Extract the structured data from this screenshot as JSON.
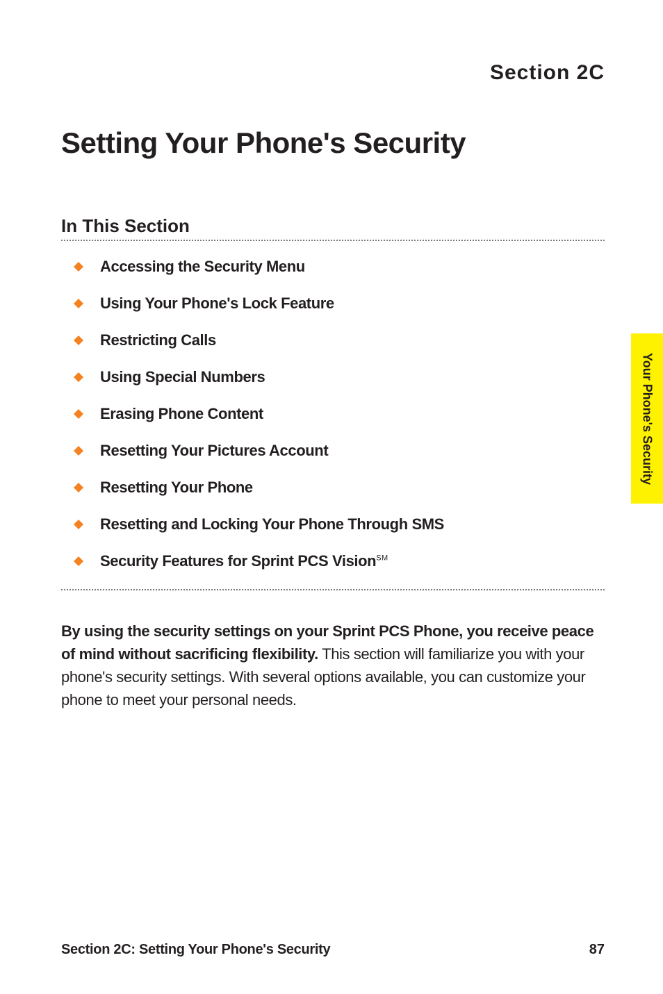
{
  "section_label": "Section 2C",
  "page_title": "Setting Your Phone's Security",
  "sub_heading": "In This Section",
  "bullets": [
    "Accessing the Security Menu",
    "Using Your Phone's Lock Feature",
    "Restricting Calls",
    "Using Special Numbers",
    "Erasing Phone Content",
    "Resetting Your Pictures Account",
    "Resetting Your Phone",
    "Resetting and Locking Your Phone Through SMS",
    "Security Features for Sprint PCS Vision"
  ],
  "last_bullet_mark": "SM",
  "body_bold": "By using the security settings on your Sprint PCS Phone, you receive peace of mind without sacrificing flexibility.",
  "body_rest": " This section will familiarize you with your phone's security settings. With several options available, you can customize your phone to meet your personal needs.",
  "side_tab": "Your Phone's Security",
  "footer_title": "Section 2C: Setting Your Phone's Security",
  "footer_page": "87",
  "colors": {
    "diamond_fill": "#f58220",
    "tab_bg": "#fff200"
  }
}
